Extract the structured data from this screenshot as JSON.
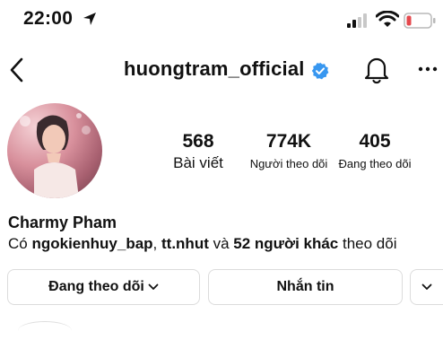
{
  "status_bar": {
    "time": "22:00",
    "icons": [
      "location-arrow-icon",
      "cellular-signal-icon",
      "wifi-icon",
      "battery-low-icon"
    ],
    "battery_color": "#e5484d"
  },
  "header": {
    "username": "huongtram_official",
    "verified_color": "#3897f0",
    "icons": [
      "back-icon",
      "verified-icon",
      "bell-icon",
      "more-icon"
    ]
  },
  "stats": [
    {
      "count": "568",
      "label": "Bài viết"
    },
    {
      "count": "774K",
      "label": "Người theo dõi"
    },
    {
      "count": "405",
      "label": "Đang theo dõi"
    }
  ],
  "profile": {
    "name": "Charmy Pham",
    "followed_by": {
      "prefix": "Có ",
      "user1": "ngokienhuy_bap",
      "sep1": ", ",
      "user2": "tt.nhut",
      "sep2": " và ",
      "others": "52 người khác",
      "suffix": " theo dõi"
    }
  },
  "buttons": {
    "following": "Đang theo dõi",
    "message": "Nhắn tin"
  }
}
